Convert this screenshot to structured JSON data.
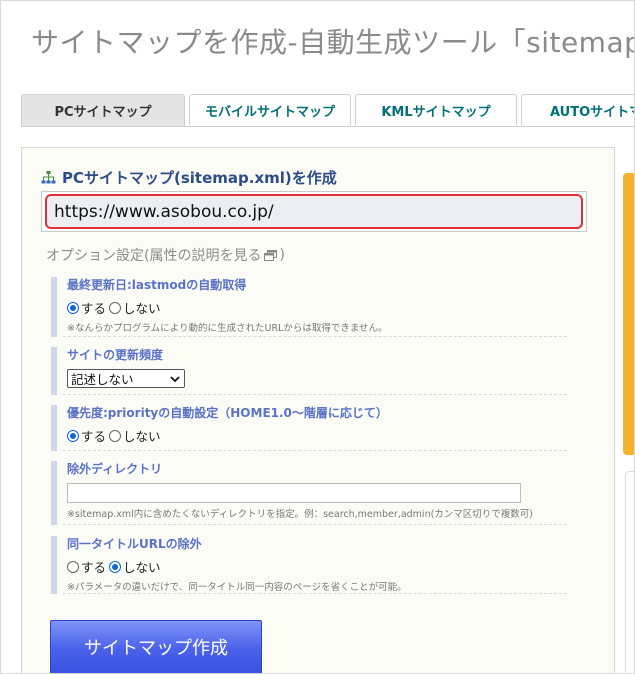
{
  "page": {
    "title": "サイトマップを作成-自動生成ツール「sitemap.xml」"
  },
  "tabs": [
    {
      "label": "PCサイトマップ",
      "active": true
    },
    {
      "label": "モバイルサイトマップ",
      "active": false
    },
    {
      "label": "KMLサイトマップ",
      "active": false
    },
    {
      "label": "AUTOサイトマップ",
      "active": false
    }
  ],
  "form": {
    "title": "PCサイトマップ(sitemap.xml)を作成",
    "url_value": "https://www.asobou.co.jp/",
    "options_heading": "オプション設定(属性の説明を見る",
    "options_heading_close": ")",
    "options": {
      "lastmod": {
        "label": "最終更新日:lastmodの自動取得",
        "yes": "する",
        "no": "しない",
        "selected": "yes",
        "note": "※なんらかプログラムにより動的に生成されたURLからは取得できません。"
      },
      "changefreq": {
        "label": "サイトの更新頻度",
        "selected_option": "記述しない"
      },
      "priority": {
        "label": "優先度:priorityの自動設定（HOME1.0～階層に応じて）",
        "yes": "する",
        "no": "しない",
        "selected": "yes"
      },
      "exclude_dir": {
        "label": "除外ディレクトリ",
        "value": "",
        "note": "※sitemap.xml内に含めたくないディレクトリを指定。例：search,member,admin(カンマ区切りで複数可)"
      },
      "same_title": {
        "label": "同一タイトルURLの除外",
        "yes": "する",
        "no": "しない",
        "selected": "no",
        "note": "※パラメータの違いだけで、同一タイトル同一内容のページを省くことが可能。"
      }
    },
    "submit_label": "サイトマップ作成"
  },
  "colors": {
    "accent": "#2d4d8a",
    "highlight": "#e0313a",
    "button": "#4a61eb",
    "side_strip": "#f3b42c"
  },
  "icons": {
    "section": "sitemap-icon",
    "external": "external-window-icon",
    "select": "chevron-down-icon"
  }
}
